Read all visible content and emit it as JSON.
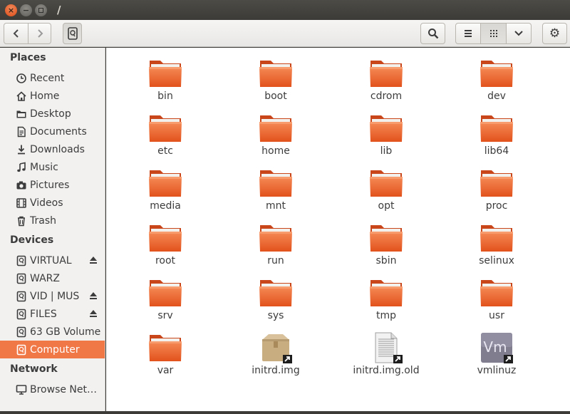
{
  "window": {
    "title": "/"
  },
  "colors": {
    "accent": "#f07746",
    "folder_top": "#f58a56",
    "folder_bottom": "#e2521c"
  },
  "toolbar": {
    "back_icon": "chevron-left-icon",
    "forward_icon": "chevron-right-icon",
    "location_icon": "drive-icon",
    "search_icon": "search-icon",
    "list_view_icon": "list-icon",
    "grid_view_icon": "grid-icon",
    "view_options_icon": "chevron-down-icon",
    "menu_icon": "gear-icon"
  },
  "sidebar": {
    "places_heading": "Places",
    "devices_heading": "Devices",
    "network_heading": "Network",
    "places": [
      {
        "label": "Recent",
        "icon": "clock-icon"
      },
      {
        "label": "Home",
        "icon": "home-icon"
      },
      {
        "label": "Desktop",
        "icon": "folder-icon"
      },
      {
        "label": "Documents",
        "icon": "document-icon"
      },
      {
        "label": "Downloads",
        "icon": "download-icon"
      },
      {
        "label": "Music",
        "icon": "music-icon"
      },
      {
        "label": "Pictures",
        "icon": "camera-icon"
      },
      {
        "label": "Videos",
        "icon": "film-icon"
      },
      {
        "label": "Trash",
        "icon": "trash-icon"
      }
    ],
    "devices": [
      {
        "label": "VIRTUAL",
        "icon": "drive-icon",
        "eject": true
      },
      {
        "label": "WARZ",
        "icon": "drive-icon",
        "eject": false
      },
      {
        "label": "VID | MUS",
        "icon": "drive-icon",
        "eject": true
      },
      {
        "label": "FILES",
        "icon": "drive-icon",
        "eject": true
      },
      {
        "label": "63 GB Volume",
        "icon": "drive-icon",
        "eject": false
      },
      {
        "label": "Computer",
        "icon": "drive-icon",
        "eject": false,
        "selected": true
      }
    ],
    "network": [
      {
        "label": "Browse Net…",
        "icon": "network-icon"
      }
    ]
  },
  "files": [
    {
      "name": "bin",
      "type": "folder"
    },
    {
      "name": "boot",
      "type": "folder"
    },
    {
      "name": "cdrom",
      "type": "folder"
    },
    {
      "name": "dev",
      "type": "folder"
    },
    {
      "name": "etc",
      "type": "folder"
    },
    {
      "name": "home",
      "type": "folder"
    },
    {
      "name": "lib",
      "type": "folder"
    },
    {
      "name": "lib64",
      "type": "folder"
    },
    {
      "name": "media",
      "type": "folder"
    },
    {
      "name": "mnt",
      "type": "folder"
    },
    {
      "name": "opt",
      "type": "folder"
    },
    {
      "name": "proc",
      "type": "folder"
    },
    {
      "name": "root",
      "type": "folder"
    },
    {
      "name": "run",
      "type": "folder"
    },
    {
      "name": "sbin",
      "type": "folder"
    },
    {
      "name": "selinux",
      "type": "folder"
    },
    {
      "name": "srv",
      "type": "folder"
    },
    {
      "name": "sys",
      "type": "folder"
    },
    {
      "name": "tmp",
      "type": "folder"
    },
    {
      "name": "usr",
      "type": "folder"
    },
    {
      "name": "var",
      "type": "folder"
    },
    {
      "name": "initrd.img",
      "type": "package-link"
    },
    {
      "name": "initrd.img.old",
      "type": "document-link"
    },
    {
      "name": "vmlinuz",
      "type": "vm-link",
      "badge": "Vm"
    }
  ]
}
